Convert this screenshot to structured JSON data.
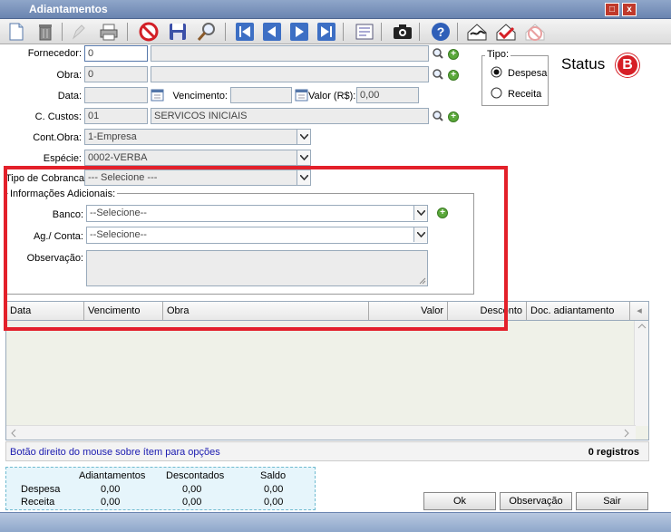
{
  "window": {
    "title": "Adiantamentos"
  },
  "form": {
    "fornecedor": {
      "label": "Fornecedor:",
      "code": "0",
      "name": ""
    },
    "obra": {
      "label": "Obra:",
      "code": "0",
      "name": ""
    },
    "data": {
      "label": "Data:",
      "value": ""
    },
    "vencimento": {
      "label": "Vencimento:",
      "value": ""
    },
    "valor": {
      "label": "Valor (R$):",
      "value": "0,00"
    },
    "c_custos": {
      "label": "C. Custos:",
      "code": "01",
      "name": "SERVICOS INICIAIS"
    },
    "cont_obra": {
      "label": "Cont.Obra:",
      "value": "1-Empresa"
    },
    "especie": {
      "label": "Espécie:",
      "value": "0002-VERBA"
    },
    "tipo_cobranca": {
      "label": "Tipo de Cobranca:",
      "value": "--- Selecione ---"
    }
  },
  "tipo": {
    "legend": "Tipo:",
    "options": [
      "Despesa",
      "Receita"
    ],
    "selected": "Despesa"
  },
  "status": {
    "label": "Status",
    "badge": "B"
  },
  "info": {
    "legend": "Informações Adicionais:",
    "banco": {
      "label": "Banco:",
      "value": "--Selecione--"
    },
    "ag_conta": {
      "label": "Ag./ Conta:",
      "value": "--Selecione--"
    },
    "observacao": {
      "label": "Observação:",
      "value": ""
    }
  },
  "grid": {
    "columns": [
      "Data",
      "Vencimento",
      "Obra",
      "Valor",
      "Desconto",
      "Doc. adiantamento"
    ],
    "hint": "Botão direito do mouse sobre ítem para opções",
    "count": "0 registros"
  },
  "summary": {
    "headers": [
      "Adiantamentos",
      "Descontados",
      "Saldo"
    ],
    "rows": [
      {
        "label": "Despesa",
        "values": [
          "0,00",
          "0,00",
          "0,00"
        ]
      },
      {
        "label": "Receita",
        "values": [
          "0,00",
          "0,00",
          "0,00"
        ]
      }
    ]
  },
  "buttons": {
    "ok": "Ok",
    "observacao": "Observação",
    "sair": "Sair"
  },
  "colors": {
    "title_bar": "#7b93bd",
    "highlight": "#e3202a",
    "status_badge": "#d61f26",
    "hint_text": "#1a1ab0"
  }
}
